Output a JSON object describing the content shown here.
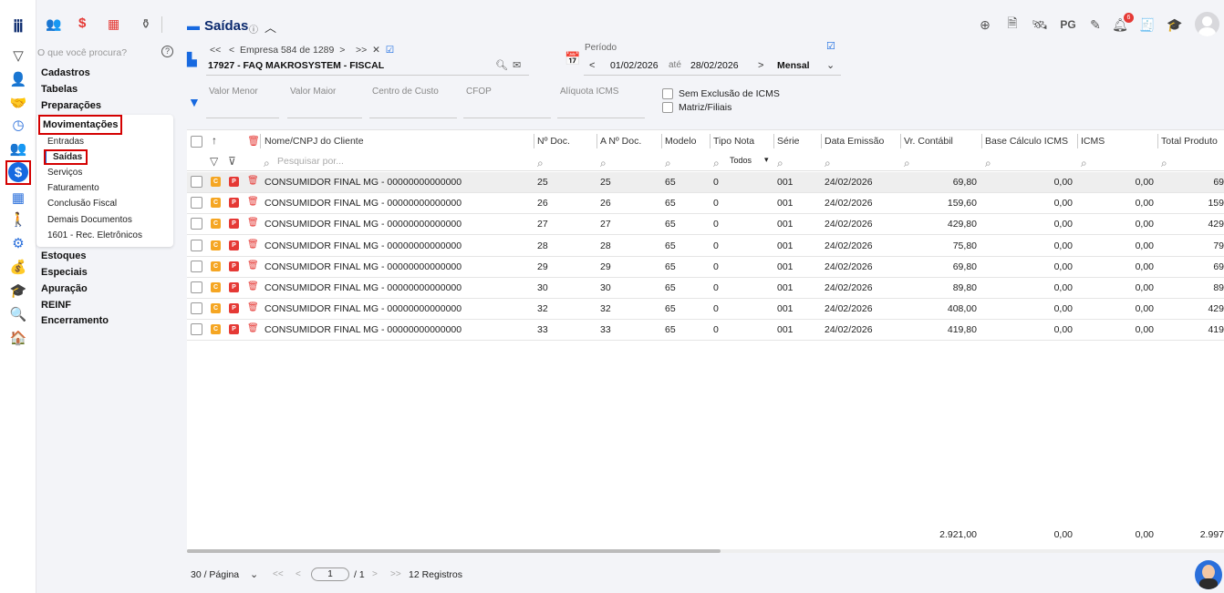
{
  "sidebar": {
    "search_placeholder": "O que você procura?",
    "menu": [
      "Cadastros",
      "Tabelas",
      "Preparações",
      "Movimentações",
      "Estoques",
      "Especiais",
      "Apuração",
      "REINF",
      "Encerramento"
    ],
    "submenu": [
      "Entradas",
      "Saídas",
      "Serviços",
      "Faturamento",
      "Conclusão Fiscal",
      "Demais Documentos",
      "1601 - Rec. Eletrônicos"
    ]
  },
  "header": {
    "title": "Saídas",
    "empresa_nav": "Empresa 584 de 1289",
    "empresa_name": "17927 - FAQ MAKROSYSTEM - FISCAL",
    "periodo_label": "Período",
    "date_from": "01/02/2026",
    "ate": "até",
    "date_to": "28/02/2026",
    "period_mode": "Mensal",
    "pg_label": "PG",
    "notif_count": "6"
  },
  "filters": {
    "valor_menor": "Valor Menor",
    "valor_maior": "Valor Maior",
    "centro_custo": "Centro de Custo",
    "cfop": "CFOP",
    "aliquota": "Alíquota ICMS",
    "sem_exclusao": "Sem Exclusão de ICMS",
    "matriz": "Matriz/Filiais"
  },
  "table": {
    "columns": [
      "Nome/CNPJ do Cliente",
      "Nº Doc.",
      "A Nº Doc.",
      "Modelo",
      "Tipo Nota",
      "Série",
      "Data Emissão",
      "Vr. Contábil",
      "Base Cálculo ICMS",
      "ICMS",
      "Total Produto"
    ],
    "search_placeholder": "Pesquisar por...",
    "tipo_filter": "Todos",
    "rows": [
      [
        "CONSUMIDOR FINAL MG - 00000000000000",
        "25",
        "25",
        "65",
        "0",
        "001",
        "24/02/2026",
        "69,80",
        "0,00",
        "0,00",
        "69"
      ],
      [
        "CONSUMIDOR FINAL MG - 00000000000000",
        "26",
        "26",
        "65",
        "0",
        "001",
        "24/02/2026",
        "159,60",
        "0,00",
        "0,00",
        "159"
      ],
      [
        "CONSUMIDOR FINAL MG - 00000000000000",
        "27",
        "27",
        "65",
        "0",
        "001",
        "24/02/2026",
        "429,80",
        "0,00",
        "0,00",
        "429"
      ],
      [
        "CONSUMIDOR FINAL MG - 00000000000000",
        "28",
        "28",
        "65",
        "0",
        "001",
        "24/02/2026",
        "75,80",
        "0,00",
        "0,00",
        "79"
      ],
      [
        "CONSUMIDOR FINAL MG - 00000000000000",
        "29",
        "29",
        "65",
        "0",
        "001",
        "24/02/2026",
        "69,80",
        "0,00",
        "0,00",
        "69"
      ],
      [
        "CONSUMIDOR FINAL MG - 00000000000000",
        "30",
        "30",
        "65",
        "0",
        "001",
        "24/02/2026",
        "89,80",
        "0,00",
        "0,00",
        "89"
      ],
      [
        "CONSUMIDOR FINAL MG - 00000000000000",
        "32",
        "32",
        "65",
        "0",
        "001",
        "24/02/2026",
        "408,00",
        "0,00",
        "0,00",
        "429"
      ],
      [
        "CONSUMIDOR FINAL MG - 00000000000000",
        "33",
        "33",
        "65",
        "0",
        "001",
        "24/02/2026",
        "419,80",
        "0,00",
        "0,00",
        "419"
      ]
    ],
    "totals": {
      "contabil": "2.921,00",
      "base": "0,00",
      "icms": "0,00",
      "produto": "2.997"
    }
  },
  "pagination": {
    "per_page": "30 / Página",
    "page": "1",
    "of": "/ 1",
    "registros": "12 Registros"
  }
}
